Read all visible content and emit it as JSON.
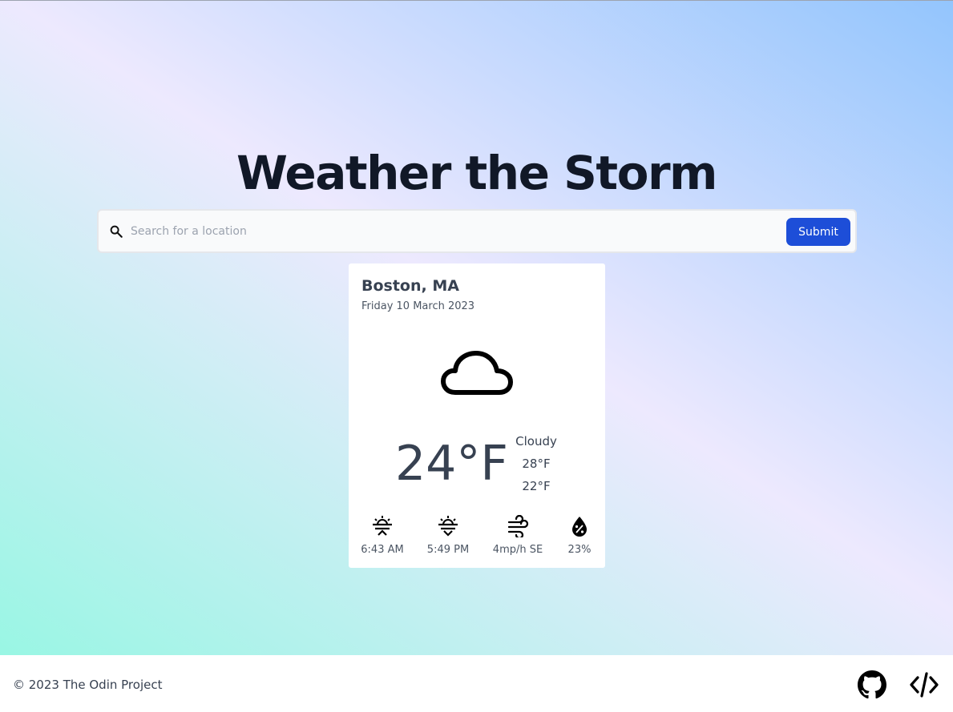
{
  "header": {
    "title": "Weather the Storm"
  },
  "search": {
    "placeholder": "Search for a location",
    "value": "",
    "submit_label": "Submit",
    "icon": "search-icon"
  },
  "weather": {
    "location": "Boston, MA",
    "date": "Friday 10 March 2023",
    "condition_icon": "cloud-icon",
    "temperature": "24°F",
    "condition": "Cloudy",
    "high": "28°F",
    "low": "22°F",
    "stats": [
      {
        "icon": "sunrise-icon",
        "value": "6:43 AM"
      },
      {
        "icon": "sunset-icon",
        "value": "5:49 PM"
      },
      {
        "icon": "wind-icon",
        "value": "4mp/h SE"
      },
      {
        "icon": "humidity-icon",
        "value": "23%"
      }
    ]
  },
  "footer": {
    "copyright": "© 2023 The Odin Project",
    "links": [
      {
        "icon": "github-icon"
      },
      {
        "icon": "code-icon"
      }
    ]
  },
  "colors": {
    "accent": "#1d4ed8",
    "title": "#111827",
    "gradient_start": "#99f6e4",
    "gradient_mid": "#ede9fe",
    "gradient_end": "#93c5fd"
  }
}
